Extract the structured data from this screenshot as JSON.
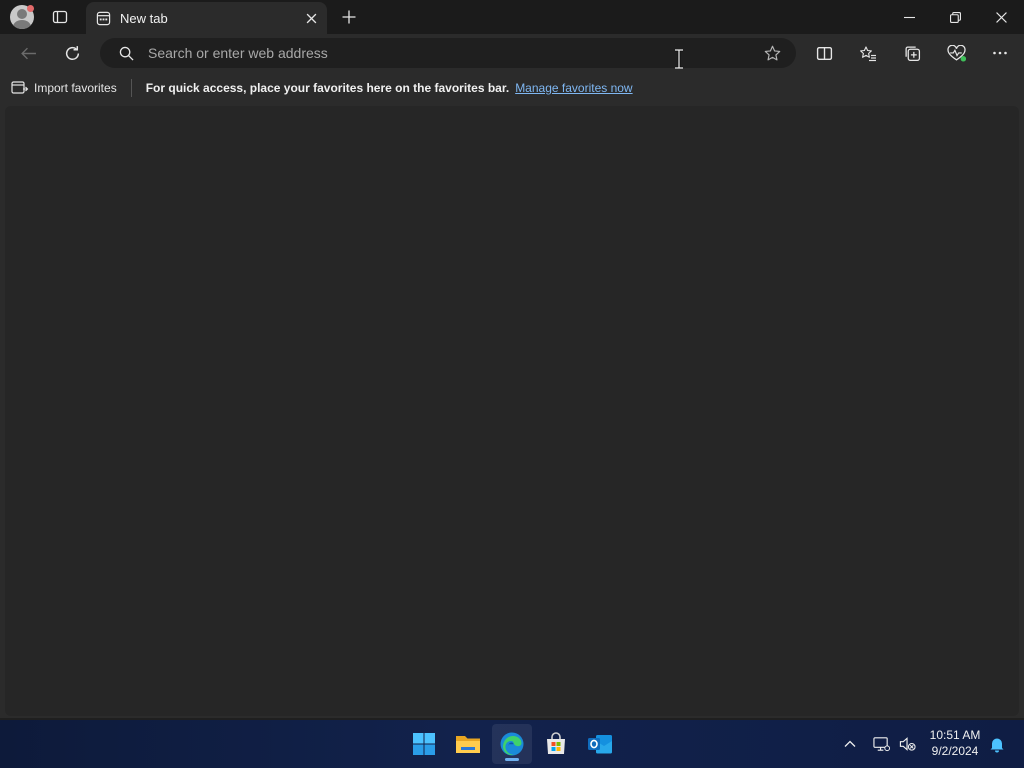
{
  "tab": {
    "title": "New tab"
  },
  "address_bar": {
    "placeholder": "Search or enter web address"
  },
  "favorites_bar": {
    "import_label": "Import favorites",
    "message": "For quick access, place your favorites here on the favorites bar.",
    "link": "Manage favorites now"
  },
  "taskbar": {
    "apps": [
      "start-icon",
      "file-explorer-icon",
      "edge-icon",
      "microsoft-store-icon",
      "outlook-icon"
    ],
    "active_app": "edge-icon"
  },
  "clock": {
    "time": "10:51 AM",
    "date": "9/2/2024"
  },
  "colors": {
    "titlebar": "#1b1b1b",
    "toolbar": "#2b2b2b",
    "content": "#262626",
    "link": "#7fb7f2",
    "taskbar": "#12224c"
  }
}
